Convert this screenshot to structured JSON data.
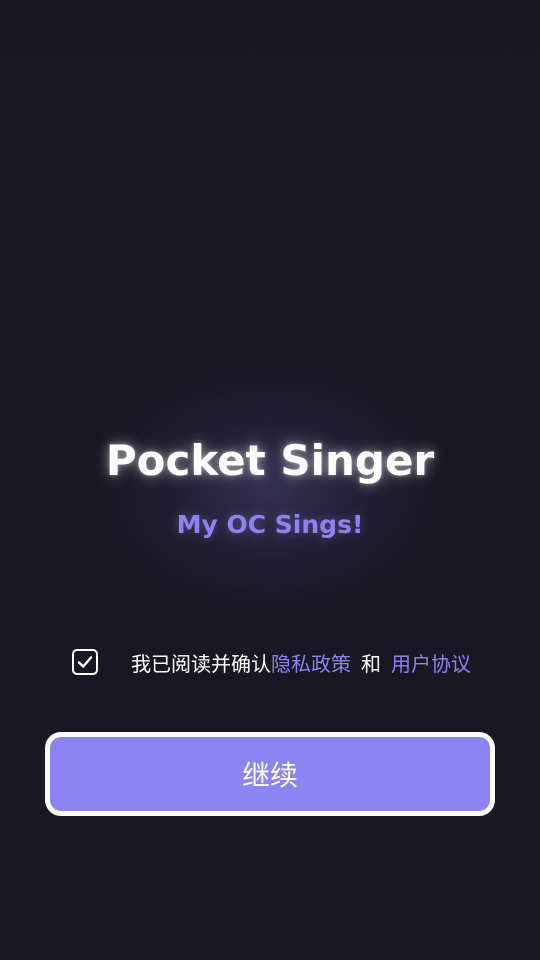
{
  "app": {
    "title": "Pocket Singer",
    "subtitle": "My OC Sings!"
  },
  "agreement": {
    "checked": true,
    "prefix": "我已阅读并确认",
    "privacy_link": "隐私政策",
    "conjunction": "和",
    "terms_link": "用户协议"
  },
  "actions": {
    "continue_label": "继续"
  },
  "colors": {
    "background": "#191724",
    "accent": "#8d83ee",
    "button": "#8c84f3",
    "text": "#ffffff"
  },
  "icons": {
    "checkbox": "check-icon"
  }
}
